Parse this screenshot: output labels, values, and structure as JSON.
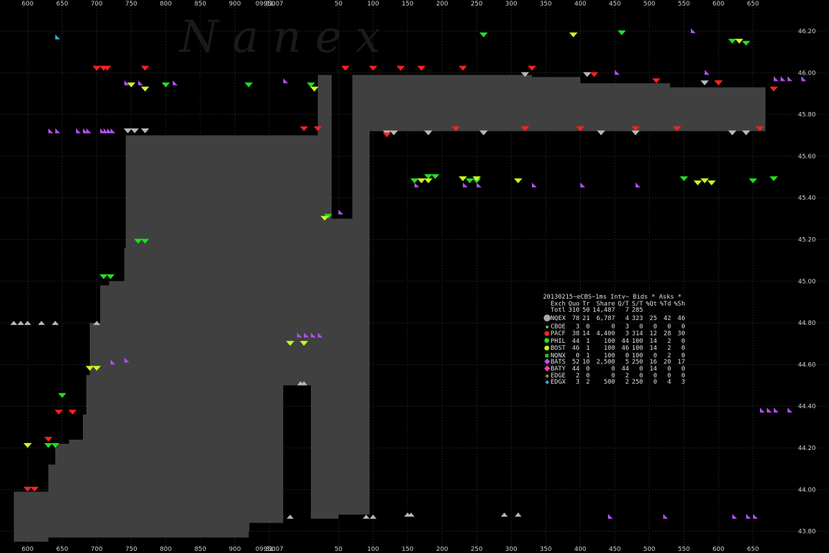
{
  "chart_data": {
    "type": "scatter",
    "title": "",
    "watermark": "N a n e x",
    "time_label": "09:31:07",
    "ylim": [
      43.75,
      46.25
    ],
    "y_ticks": [
      "46.20",
      "46.00",
      "45.80",
      "45.60",
      "45.40",
      "45.20",
      "45.00",
      "44.80",
      "44.60",
      "44.40",
      "44.20",
      "44.00",
      "43.80"
    ],
    "x_ticks_before": [
      "600",
      "650",
      "700",
      "750",
      "800",
      "850",
      "900",
      "950"
    ],
    "x_ticks_after": [
      "50",
      "100",
      "150",
      "200",
      "250",
      "300",
      "350",
      "400",
      "450",
      "500",
      "550",
      "600",
      "650"
    ],
    "x_unit": "ms within second",
    "grid": true,
    "nbbo_spread": [
      {
        "x": 600,
        "bid": 43.75,
        "ask": 43.99
      },
      {
        "x": 630,
        "bid": 43.75,
        "ask": 43.99
      },
      {
        "x": 650,
        "bid": 43.77,
        "ask": 44.12
      },
      {
        "x": 660,
        "bid": 43.77,
        "ask": 44.22
      },
      {
        "x": 680,
        "bid": 43.77,
        "ask": 44.24
      },
      {
        "x": 700,
        "bid": 43.77,
        "ask": 44.36
      },
      {
        "x": 705,
        "bid": 43.77,
        "ask": 44.55
      },
      {
        "x": 710,
        "bid": 43.77,
        "ask": 44.8
      },
      {
        "x": 722,
        "bid": 43.77,
        "ask": 44.8
      },
      {
        "x": 725,
        "bid": 43.77,
        "ask": 44.98
      },
      {
        "x": 738,
        "bid": 43.77,
        "ask": 45.0
      },
      {
        "x": 760,
        "bid": 43.77,
        "ask": 45.16
      },
      {
        "x": 762,
        "bid": 43.77,
        "ask": 45.7
      },
      {
        "x": 940,
        "bid": 43.8,
        "ask": 45.7
      },
      {
        "x": 941,
        "bid": 43.84,
        "ask": 45.7
      },
      {
        "x": 990,
        "bid": 44.5,
        "ask": 45.7
      },
      {
        "x": 1030,
        "bid": 43.86,
        "ask": 45.7
      },
      {
        "x": 1040,
        "bid": 43.86,
        "ask": 45.99
      },
      {
        "x": 1050,
        "bid": 43.86,
        "ask": 45.99
      },
      {
        "x": 1060,
        "bid": 43.86,
        "ask": 45.3
      },
      {
        "x": 1070,
        "bid": 43.88,
        "ask": 45.3
      },
      {
        "x": 1090,
        "bid": 43.88,
        "ask": 45.99
      },
      {
        "x": 1115,
        "bid": 45.72,
        "ask": 45.99
      },
      {
        "x": 1350,
        "bid": 45.72,
        "ask": 45.98
      },
      {
        "x": 1420,
        "bid": 45.72,
        "ask": 45.95
      },
      {
        "x": 1550,
        "bid": 45.72,
        "ask": 45.93
      },
      {
        "x": 1680,
        "bid": 45.72,
        "ask": 45.93
      }
    ],
    "exchange_quotes": [
      {
        "ex": "NQEX",
        "points": [
          [
            600,
            44.8
          ],
          [
            610,
            44.8
          ],
          [
            620,
            44.8
          ],
          [
            640,
            44.8
          ],
          [
            660,
            44.8
          ],
          [
            720,
            44.8
          ],
          [
            765,
            45.72
          ],
          [
            775,
            45.72
          ],
          [
            790,
            45.72
          ],
          [
            1000,
            43.87
          ],
          [
            1015,
            44.51
          ],
          [
            1020,
            44.51
          ],
          [
            1110,
            43.87
          ],
          [
            1120,
            43.87
          ],
          [
            1140,
            45.71
          ],
          [
            1150,
            45.71
          ],
          [
            1170,
            43.88
          ],
          [
            1175,
            43.88
          ],
          [
            1200,
            45.71
          ],
          [
            1280,
            45.71
          ],
          [
            1310,
            43.88
          ],
          [
            1330,
            43.88
          ],
          [
            1340,
            45.99
          ],
          [
            1430,
            45.99
          ],
          [
            1450,
            45.71
          ],
          [
            1500,
            45.71
          ],
          [
            1600,
            45.95
          ],
          [
            1620,
            45.95
          ],
          [
            1640,
            45.71
          ],
          [
            1660,
            45.71
          ]
        ]
      },
      {
        "ex": "PACF",
        "points": [
          [
            620,
            44.0
          ],
          [
            630,
            44.0
          ],
          [
            650,
            44.24
          ],
          [
            665,
            44.37
          ],
          [
            685,
            44.37
          ],
          [
            720,
            46.02
          ],
          [
            730,
            46.02
          ],
          [
            735,
            46.02
          ],
          [
            790,
            46.02
          ],
          [
            1020,
            45.73
          ],
          [
            1040,
            45.73
          ],
          [
            1080,
            46.02
          ],
          [
            1120,
            46.02
          ],
          [
            1140,
            45.7
          ],
          [
            1160,
            46.02
          ],
          [
            1190,
            46.02
          ],
          [
            1240,
            45.73
          ],
          [
            1250,
            46.02
          ],
          [
            1340,
            45.73
          ],
          [
            1350,
            46.02
          ],
          [
            1420,
            45.73
          ],
          [
            1440,
            45.99
          ],
          [
            1500,
            45.73
          ],
          [
            1530,
            45.96
          ],
          [
            1560,
            45.73
          ],
          [
            1620,
            45.95
          ],
          [
            1680,
            45.73
          ],
          [
            1700,
            45.92
          ]
        ]
      },
      {
        "ex": "PHIL",
        "points": [
          [
            650,
            44.21
          ],
          [
            660,
            44.21
          ],
          [
            670,
            44.45
          ],
          [
            730,
            45.02
          ],
          [
            740,
            45.02
          ],
          [
            780,
            45.19
          ],
          [
            790,
            45.19
          ],
          [
            820,
            45.94
          ],
          [
            940,
            45.94
          ],
          [
            1030,
            45.94
          ],
          [
            1055,
            45.31
          ],
          [
            1180,
            45.48
          ],
          [
            1200,
            45.5
          ],
          [
            1210,
            45.5
          ],
          [
            1260,
            45.48
          ],
          [
            1270,
            45.48
          ],
          [
            1280,
            46.18
          ],
          [
            1480,
            46.19
          ],
          [
            1570,
            45.49
          ],
          [
            1640,
            46.15
          ],
          [
            1660,
            46.14
          ],
          [
            1670,
            45.48
          ],
          [
            1700,
            45.49
          ]
        ]
      },
      {
        "ex": "BOST",
        "points": [
          [
            620,
            44.21
          ],
          [
            710,
            44.58
          ],
          [
            720,
            44.58
          ],
          [
            770,
            45.94
          ],
          [
            790,
            45.92
          ],
          [
            1000,
            44.7
          ],
          [
            1020,
            44.7
          ],
          [
            1035,
            45.92
          ],
          [
            1050,
            45.3
          ],
          [
            1190,
            45.48
          ],
          [
            1200,
            45.48
          ],
          [
            1250,
            45.49
          ],
          [
            1270,
            45.49
          ],
          [
            1330,
            45.48
          ],
          [
            1410,
            46.18
          ],
          [
            1590,
            45.47
          ],
          [
            1600,
            45.48
          ],
          [
            1610,
            45.47
          ],
          [
            1650,
            46.15
          ]
        ]
      },
      {
        "ex": "BATS",
        "points": [
          [
            650,
            45.72
          ],
          [
            660,
            45.72
          ],
          [
            690,
            45.72
          ],
          [
            700,
            45.72
          ],
          [
            705,
            45.72
          ],
          [
            725,
            45.72
          ],
          [
            730,
            45.72
          ],
          [
            735,
            45.72
          ],
          [
            740,
            45.72
          ],
          [
            740,
            44.61
          ],
          [
            760,
            44.62
          ],
          [
            760,
            45.95
          ],
          [
            780,
            45.95
          ],
          [
            830,
            45.95
          ],
          [
            990,
            45.96
          ],
          [
            1010,
            44.74
          ],
          [
            1020,
            44.74
          ],
          [
            1030,
            44.74
          ],
          [
            1040,
            44.74
          ],
          [
            1070,
            45.33
          ],
          [
            1180,
            45.46
          ],
          [
            1250,
            45.46
          ],
          [
            1270,
            45.46
          ],
          [
            1350,
            45.46
          ],
          [
            1420,
            45.46
          ],
          [
            1470,
            46.0
          ],
          [
            1500,
            45.46
          ],
          [
            1580,
            46.2
          ],
          [
            1600,
            46.0
          ],
          [
            1680,
            44.38
          ],
          [
            1690,
            44.38
          ],
          [
            1700,
            44.38
          ],
          [
            1720,
            44.38
          ],
          [
            1700,
            45.97
          ],
          [
            1710,
            45.97
          ],
          [
            1720,
            45.97
          ],
          [
            1740,
            45.97
          ],
          [
            1460,
            43.87
          ],
          [
            1540,
            43.87
          ],
          [
            1640,
            43.87
          ],
          [
            1660,
            43.87
          ],
          [
            1670,
            43.87
          ]
        ]
      },
      {
        "ex": "EDGX",
        "points": [
          [
            660,
            46.17
          ]
        ]
      }
    ],
    "series": [
      {
        "name": "NQEX",
        "quotes": 78,
        "trades": 21,
        "shares": "6,787",
        "q_per_t": "4",
        "s_per_t": "323",
        "pct_qt": "25",
        "pct_td": "42",
        "pct_sh": "46"
      },
      {
        "name": "CBOE",
        "quotes": 3,
        "trades": 0,
        "shares": "0",
        "q_per_t": "3",
        "s_per_t": "0",
        "pct_qt": "0",
        "pct_td": "0",
        "pct_sh": "0"
      },
      {
        "name": "PACF",
        "quotes": 38,
        "trades": 14,
        "shares": "4,400",
        "q_per_t": "3",
        "s_per_t": "314",
        "pct_qt": "12",
        "pct_td": "28",
        "pct_sh": "30"
      },
      {
        "name": "PHIL",
        "quotes": 44,
        "trades": 1,
        "shares": "100",
        "q_per_t": "44",
        "s_per_t": "100",
        "pct_qt": "14",
        "pct_td": "2",
        "pct_sh": "0"
      },
      {
        "name": "BOST",
        "quotes": 46,
        "trades": 1,
        "shares": "100",
        "q_per_t": "46",
        "s_per_t": "100",
        "pct_qt": "14",
        "pct_td": "2",
        "pct_sh": "0"
      },
      {
        "name": "NQNX",
        "quotes": 0,
        "trades": 1,
        "shares": "100",
        "q_per_t": "0",
        "s_per_t": "100",
        "pct_qt": "0",
        "pct_td": "2",
        "pct_sh": "0"
      },
      {
        "name": "BATS",
        "quotes": 52,
        "trades": 10,
        "shares": "2,500",
        "q_per_t": "5",
        "s_per_t": "250",
        "pct_qt": "16",
        "pct_td": "20",
        "pct_sh": "17"
      },
      {
        "name": "BATY",
        "quotes": 44,
        "trades": 0,
        "shares": "0",
        "q_per_t": "44",
        "s_per_t": "0",
        "pct_qt": "14",
        "pct_td": "0",
        "pct_sh": "0"
      },
      {
        "name": "EDGE",
        "quotes": 2,
        "trades": 0,
        "shares": "0",
        "q_per_t": "2",
        "s_per_t": "0",
        "pct_qt": "0",
        "pct_td": "0",
        "pct_sh": "0"
      },
      {
        "name": "EDGX",
        "quotes": 3,
        "trades": 2,
        "shares": "500",
        "q_per_t": "2",
        "s_per_t": "250",
        "pct_qt": "0",
        "pct_td": "4",
        "pct_sh": "3"
      }
    ]
  },
  "stats_panel": {
    "title": "20130215~eCBS~1ms Intv~ Bids * Asks *",
    "headers": [
      "Exch",
      "Quo",
      "Tr",
      "Share",
      "Q/T",
      "S/T",
      "%Qt",
      "%Td",
      "%Sh"
    ],
    "total": {
      "name": "Totl",
      "quo": "310",
      "tr": "50",
      "share": "14,487",
      "qt": "7",
      "st": "285",
      "pqt": "",
      "ptd": "",
      "psh": ""
    },
    "rows": [
      {
        "name": "NQEX",
        "marker": "dot-large",
        "color": "#a8a8a8",
        "quo": "78",
        "tr": "21",
        "share": "6,787",
        "qt": "4",
        "st": "323",
        "pqt": "25",
        "ptd": "42",
        "psh": "46"
      },
      {
        "name": "CBOE",
        "marker": "dot-small",
        "color": "#6fbf2f",
        "quo": "3",
        "tr": "0",
        "share": "0",
        "qt": "3",
        "st": "0",
        "pqt": "0",
        "ptd": "0",
        "psh": "0"
      },
      {
        "name": "PACF",
        "marker": "dot-medium",
        "color": "#ff2020",
        "quo": "38",
        "tr": "14",
        "share": "4,400",
        "qt": "3",
        "st": "314",
        "pqt": "12",
        "ptd": "28",
        "psh": "30"
      },
      {
        "name": "PHIL",
        "marker": "dot-medium",
        "color": "#20e020",
        "quo": "44",
        "tr": "1",
        "share": "100",
        "qt": "44",
        "st": "100",
        "pqt": "14",
        "ptd": "2",
        "psh": "0"
      },
      {
        "name": "BOST",
        "marker": "dot-medium",
        "color": "#b8ff20",
        "quo": "46",
        "tr": "1",
        "share": "100",
        "qt": "46",
        "st": "100",
        "pqt": "14",
        "ptd": "2",
        "psh": "0"
      },
      {
        "name": "NQNX",
        "marker": "square-small",
        "color": "#20c020",
        "quo": "0",
        "tr": "1",
        "share": "100",
        "qt": "0",
        "st": "100",
        "pqt": "0",
        "ptd": "2",
        "psh": "0"
      },
      {
        "name": "BATS",
        "marker": "diamond",
        "color": "#c050f0",
        "quo": "52",
        "tr": "10",
        "share": "2,500",
        "qt": "5",
        "st": "250",
        "pqt": "16",
        "ptd": "20",
        "psh": "17"
      },
      {
        "name": "BATY",
        "marker": "diamond",
        "color": "#ff40c0",
        "quo": "44",
        "tr": "0",
        "share": "0",
        "qt": "44",
        "st": "0",
        "pqt": "14",
        "ptd": "0",
        "psh": "0"
      },
      {
        "name": "EDGE",
        "marker": "diamond-small",
        "color": "#b08040",
        "quo": "2",
        "tr": "0",
        "share": "0",
        "qt": "2",
        "st": "0",
        "pqt": "0",
        "ptd": "0",
        "psh": "0"
      },
      {
        "name": "EDGX",
        "marker": "diamond-small",
        "color": "#3fa8e0",
        "quo": "3",
        "tr": "2",
        "share": "500",
        "qt": "2",
        "st": "250",
        "pqt": "0",
        "ptd": "4",
        "psh": "3"
      }
    ]
  },
  "colors": {
    "background": "#000000",
    "grid": "#3a3a3a",
    "spread_fill": "#404040",
    "NQEX": "#b8b8b8",
    "PACF": "#ff2020",
    "PHIL": "#20e020",
    "BOST": "#c8ff20",
    "BATS": "#b050f0",
    "BATY": "#ff40c0",
    "EDGX": "#3fa8e0"
  }
}
